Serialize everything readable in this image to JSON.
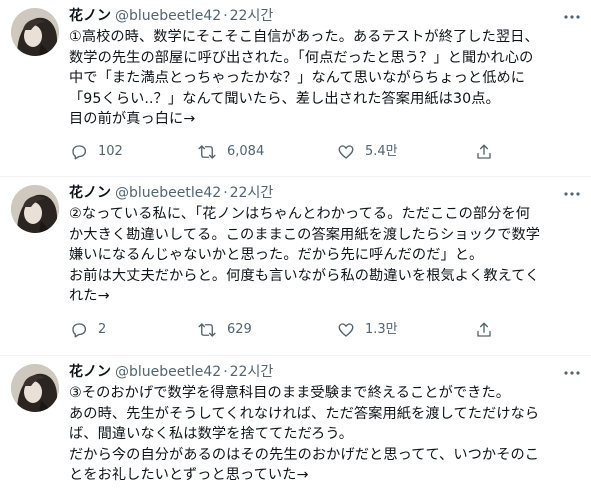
{
  "tweets": [
    {
      "name": "花ノン",
      "handle": "@bluebeetle42",
      "separator": "·",
      "time": "22시간",
      "text": "①高校の時、数学にそこそこ自信があった。あるテストが終了した翌日、\n数学の先生の部屋に呼び出された。「何点だったと思う？」と聞かれ心の\n中で「また満点とっちゃったかな？」なんて思いながらちょっと低めに\n「95くらい..？」なんて聞いたら、差し出された答案用紙は30点。\n目の前が真っ白に→",
      "replies": "102",
      "retweets": "6,084",
      "likes": "5.4만"
    },
    {
      "name": "花ノン",
      "handle": "@bluebeetle42",
      "separator": "·",
      "time": "22시간",
      "text": "②なっている私に、「花ノンはちゃんとわかってる。ただここの部分を何\nか大きく勘違いしてる。このままこの答案用紙を渡したらショックで数学\n嫌いになるんじゃないかと思った。だから先に呼んだのだ」と。\nお前は大丈夫だからと。何度も言いながら私の勘違いを根気よく教えてく\nれた→",
      "replies": "2",
      "retweets": "629",
      "likes": "1.3만"
    },
    {
      "name": "花ノン",
      "handle": "@bluebeetle42",
      "separator": "·",
      "time": "22시간",
      "text": "③そのおかげで数学を得意科目のまま受験まで終えることができた。\nあの時、先生がそうしてくれなければ、ただ答案用紙を渡してただけなら\nば、間違いなく私は数学を捨ててただろう。\nだから今の自分があるのはその先生のおかげだと思ってて、いつかそのこ\nとをお礼したいとずっと思っていた→",
      "replies": "",
      "retweets": "",
      "likes": ""
    }
  ],
  "icons": {
    "reply": "reply-icon",
    "retweet": "retweet-icon",
    "like": "heart-icon",
    "share": "share-icon",
    "more": "more-icon"
  },
  "colors": {
    "text": "#0f1419",
    "secondary": "#536471",
    "divider": "#eff3f4"
  }
}
